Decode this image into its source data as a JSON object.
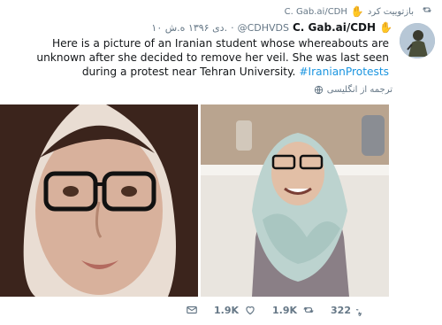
{
  "retweet": {
    "label": "بازتوییت کرد",
    "by": "C. Gab.ai/CDH"
  },
  "author": {
    "name": "C. Gab.ai/CDH",
    "handle": "@CDHVDS",
    "date": "۱۰ دی ۱۳۹۶ ه.ش."
  },
  "tweet": {
    "text": "Here is a picture of an Iranian student whose whereabouts are unknown after she decided to remove her veil. She was last seen during a protest near Tehran University.",
    "hashtag": "#IranianProtests",
    "translate_label": "ترجمه از انگلیسی"
  },
  "actions": {
    "likes": "1.9K",
    "retweets": "1.9K",
    "replies": "322"
  },
  "colors": {
    "link": "#1b95e0",
    "muted": "#657786",
    "text": "#14171a"
  },
  "icons": {
    "retweet": "retweet-icon",
    "hand": "raised-hand-icon",
    "globe": "globe-icon",
    "like": "heart-icon",
    "reply": "reply-icon",
    "dm": "mail-icon"
  }
}
